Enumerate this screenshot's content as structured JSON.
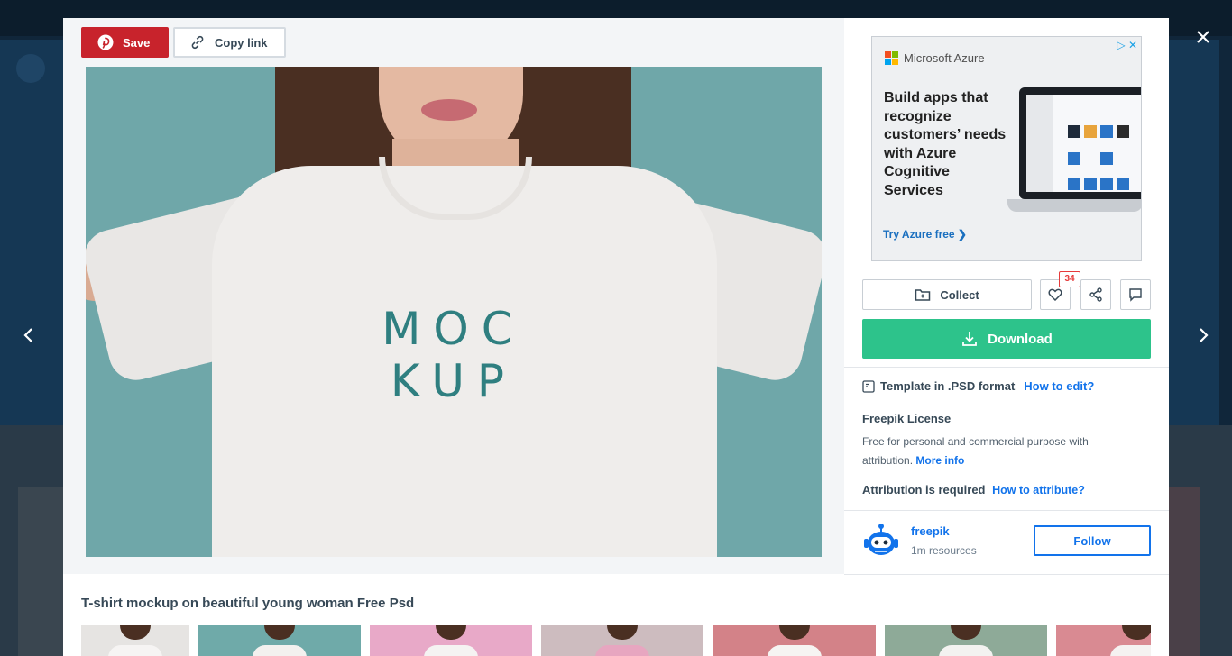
{
  "toolbar": {
    "save_label": "Save",
    "copy_link_label": "Copy link"
  },
  "image": {
    "mockup_line1": "MOC",
    "mockup_line2": "KUP",
    "alt": "T-shirt mockup on beautiful young woman Free Psd"
  },
  "ad": {
    "brand": "Microsoft Azure",
    "headline": "Build apps that recognize customers’ needs with Azure Cognitive Services",
    "cta": "Try Azure free ❯"
  },
  "actions": {
    "collect_label": "Collect",
    "like_count": "34",
    "download_label": "Download"
  },
  "details": {
    "format_text": "Template in .PSD format",
    "how_to_edit": "How to edit?",
    "license_title": "Freepik License",
    "license_text": "Free for personal and commercial purpose with attribution.",
    "more_info": "More info",
    "attribution_text": "Attribution is required",
    "how_to_attribute": "How to attribute?"
  },
  "author": {
    "name": "freepik",
    "resources": "1m resources",
    "follow_label": "Follow"
  },
  "related": {
    "title": "T-shirt mockup on beautiful young woman Free Psd",
    "thumbs": [
      {
        "bg": "#e6e4e2",
        "tee": "#f6f4f3"
      },
      {
        "bg": "#6faaa9",
        "tee": "#f3f1ef"
      },
      {
        "bg": "#e8a9c8",
        "tee": "#f5f3f2"
      },
      {
        "bg": "#cdbcbf",
        "tee": "#e7a6c0"
      },
      {
        "bg": "#d38288",
        "tee": "#f6f4f2"
      },
      {
        "bg": "#8eaa98",
        "tee": "#f3f2f0"
      },
      {
        "bg": "#d98a92",
        "tee": "#f5f2f1"
      }
    ]
  },
  "colors": {
    "save": "#c8232c",
    "download": "#2dc38b",
    "link": "#1273eb",
    "like_badge": "#e63b3b"
  }
}
